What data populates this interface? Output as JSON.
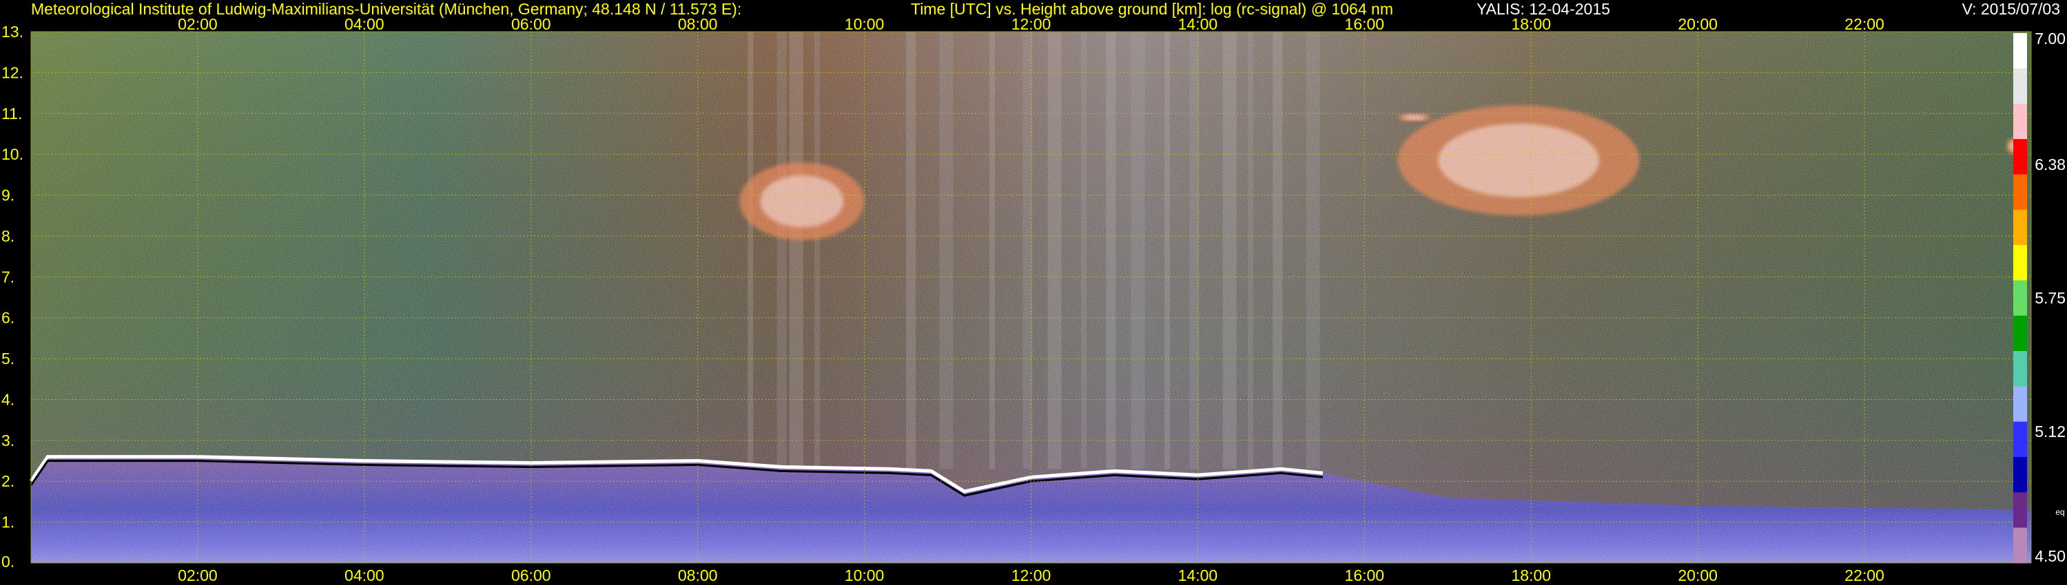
{
  "header": {
    "institute": "Meteorological Institute of Ludwig-Maximilians-Universität (München, Germany; 48.148 N / 11.573 E):",
    "description": "Time [UTC] vs. Height above ground [km]: log (rc-signal) @ 1064 nm",
    "instrument_date": "YALIS: 12-04-2015",
    "version": "V: 2015/07/03"
  },
  "colorbar": {
    "labels": [
      "7.00",
      "6.38",
      "5.75",
      "5.12",
      "4.50"
    ],
    "values": [
      7.0,
      6.38,
      5.75,
      5.12,
      4.5
    ],
    "unit": "eq",
    "colors": [
      "#ffffff",
      "#e6e6e6",
      "#ffc0c8",
      "#ff0000",
      "#ff6a00",
      "#ffb000",
      "#ffff00",
      "#66dd66",
      "#00a000",
      "#55ccaa",
      "#9ab4ff",
      "#3030ff",
      "#0000b0",
      "#6a2a8a",
      "#b888b8"
    ]
  },
  "chart_data": {
    "type": "heatmap",
    "title": "Time [UTC] vs. Height above ground [km]: log (rc-signal) @ 1064 nm",
    "xlabel": "Time [UTC]",
    "ylabel": "Height above ground [km]",
    "x_ticks": [
      "02:00",
      "04:00",
      "06:00",
      "08:00",
      "10:00",
      "12:00",
      "14:00",
      "16:00",
      "18:00",
      "20:00",
      "22:00"
    ],
    "x_tick_hours": [
      2,
      4,
      6,
      8,
      10,
      12,
      14,
      16,
      18,
      20,
      22
    ],
    "y_ticks": [
      "0.",
      "1.",
      "2.",
      "3.",
      "4.",
      "5.",
      "6.",
      "7.",
      "8.",
      "9.",
      "10.",
      "11.",
      "12.",
      "13."
    ],
    "y_tick_values": [
      0,
      1,
      2,
      3,
      4,
      5,
      6,
      7,
      8,
      9,
      10,
      11,
      12,
      13
    ],
    "xlim": [
      0,
      24
    ],
    "ylim": [
      0,
      13
    ],
    "zlim": [
      4.5,
      7.0
    ],
    "grid": true,
    "boundary_layer_top_km": [
      {
        "t": 0.0,
        "h": 2.0
      },
      {
        "t": 0.2,
        "h": 2.6
      },
      {
        "t": 2.0,
        "h": 2.6
      },
      {
        "t": 4.0,
        "h": 2.5
      },
      {
        "t": 6.0,
        "h": 2.45
      },
      {
        "t": 8.0,
        "h": 2.5
      },
      {
        "t": 9.0,
        "h": 2.35
      },
      {
        "t": 10.3,
        "h": 2.3
      },
      {
        "t": 10.8,
        "h": 2.25
      },
      {
        "t": 11.2,
        "h": 1.75
      },
      {
        "t": 12.0,
        "h": 2.1
      },
      {
        "t": 13.0,
        "h": 2.25
      },
      {
        "t": 14.0,
        "h": 2.15
      },
      {
        "t": 15.0,
        "h": 2.3
      },
      {
        "t": 15.5,
        "h": 2.2
      }
    ],
    "cloud_patches": [
      {
        "t_start": 8.5,
        "t_end": 10.0,
        "h_min": 7.9,
        "h_max": 9.8
      },
      {
        "t_start": 16.4,
        "t_end": 16.8,
        "h_min": 10.8,
        "h_max": 11.0
      },
      {
        "t_start": 16.4,
        "t_end": 19.3,
        "h_min": 8.5,
        "h_max": 11.2
      },
      {
        "t_start": 23.7,
        "t_end": 23.9,
        "h_min": 10.0,
        "h_max": 10.4
      }
    ]
  }
}
